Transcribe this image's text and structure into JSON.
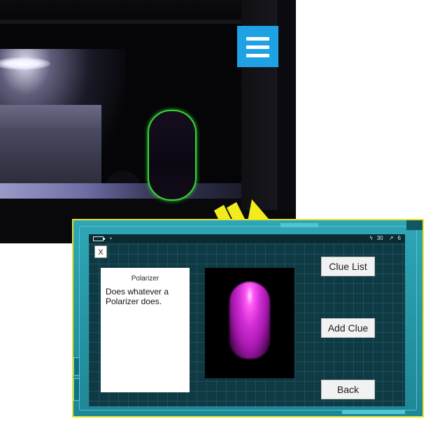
{
  "scene": {
    "menu_icon": "hamburger-icon",
    "arrow_icon": "arrow-right-icon",
    "colors": {
      "menu": "#1ea2e6",
      "outline": "#37d43a",
      "arrow": "#f2ec1c",
      "device": "#2fa6b6"
    }
  },
  "device": {
    "status": {
      "battery_icon": "battery-icon",
      "wifi_icon": "wifi-icon",
      "energy": "30",
      "tools": "6"
    },
    "close_label": "X",
    "clue": {
      "title": "Polarizer",
      "description": "Does whatever a Polarizer does."
    },
    "preview_icon": "glowing-capsule",
    "buttons": {
      "clue_list": "Clue List",
      "add_clue": "Add Clue",
      "back": "Back"
    }
  }
}
